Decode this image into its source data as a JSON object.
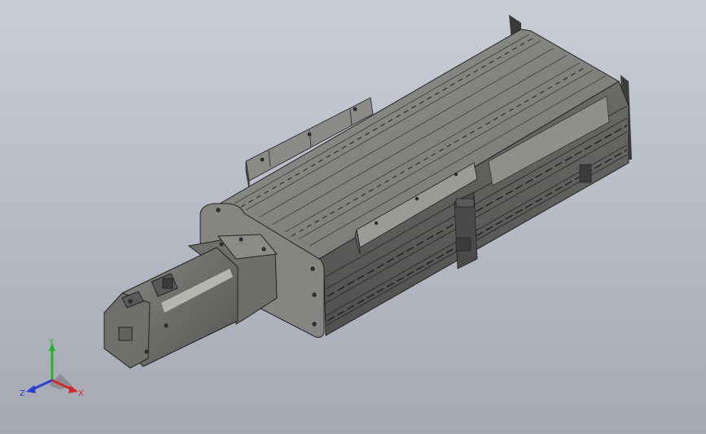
{
  "viewport": {
    "background_top": "#c9cdd6",
    "background_bottom": "#a6a9b3"
  },
  "model": {
    "body_color": "#7b7c79",
    "body_light": "#9a9b97",
    "body_dark": "#4f504d",
    "edge_color": "#222222",
    "motor_color": "#6a6b67"
  },
  "triad": {
    "x_label": "X",
    "y_label": "Y",
    "z_label": "Z",
    "x_color": "#d12b2b",
    "y_color": "#28b428",
    "z_color": "#2b3fd1"
  }
}
